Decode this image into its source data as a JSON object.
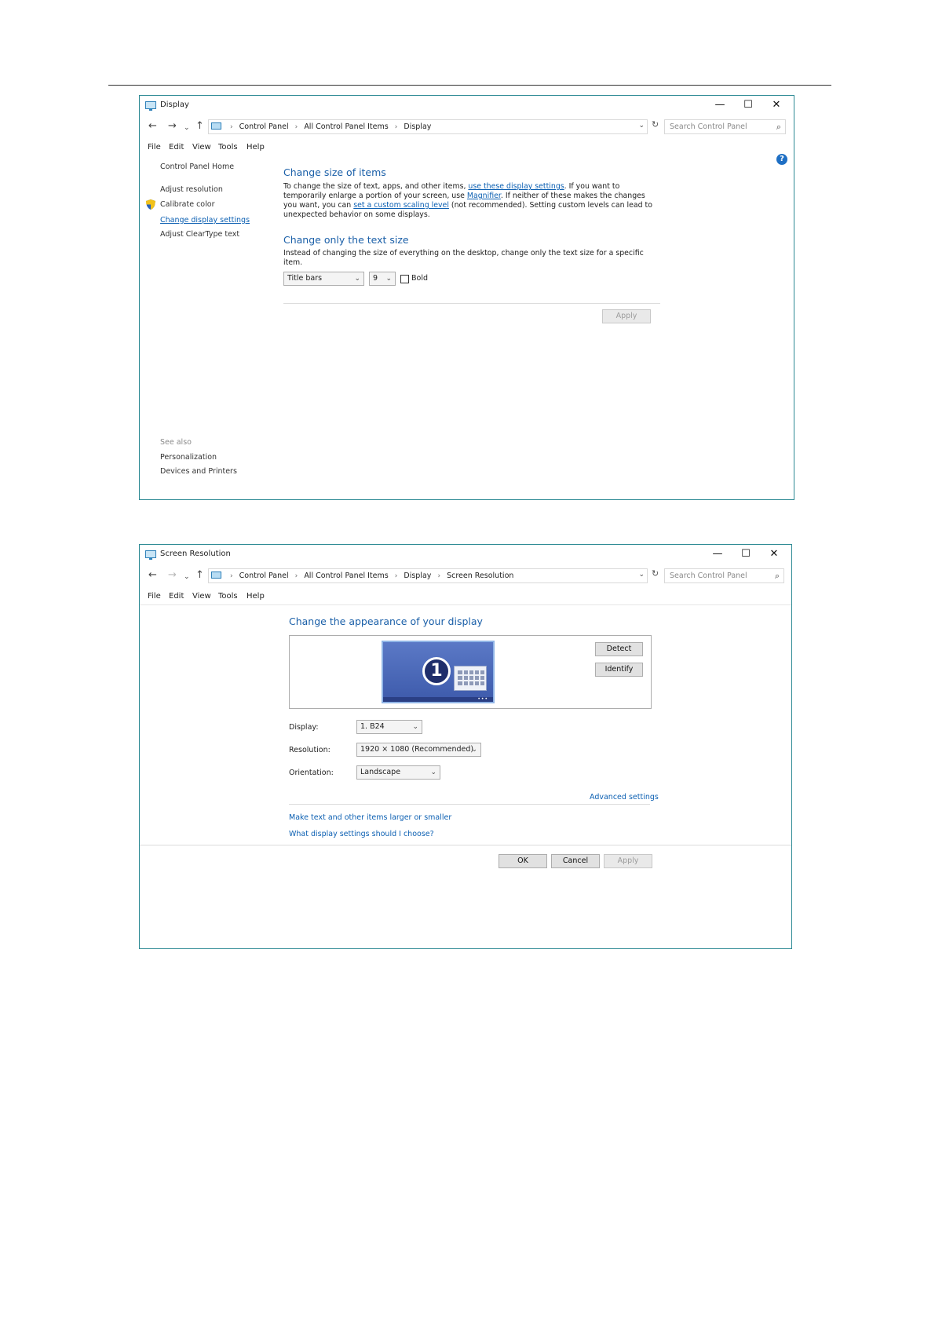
{
  "win1": {
    "title": "Display",
    "controls": {
      "minimize": "—",
      "maximize": "☐",
      "close": "✕"
    },
    "nav": {
      "back": "←",
      "forward": "→",
      "recent": "⌄",
      "up": "↑"
    },
    "breadcrumb": [
      "Control Panel",
      "All Control Panel Items",
      "Display"
    ],
    "search_placeholder": "Search Control Panel",
    "menu": [
      "File",
      "Edit",
      "View",
      "Tools",
      "Help"
    ],
    "help": "?",
    "sidebar": {
      "home": "Control Panel Home",
      "items": [
        "Adjust resolution",
        "Calibrate color",
        "Change display settings",
        "Adjust ClearType text"
      ],
      "see_also": "See also",
      "see_also_items": [
        "Personalization",
        "Devices and Printers"
      ]
    },
    "section1": {
      "heading": "Change size of items",
      "p1": "To change the size of text, apps, and other items, ",
      "link1": "use these display settings",
      "p2": ". If you want to temporarily enlarge a portion of your screen, use ",
      "link2": "Magnifier",
      "p3": ". If neither of these makes the changes you want, you can ",
      "link3": "set a custom scaling level",
      "p4": " (not recommended).  Setting custom levels can lead to unexpected behavior on some displays."
    },
    "section2": {
      "heading": "Change only the text size",
      "text": "Instead of changing the size of everything on the desktop, change only the text size for a specific item.",
      "item_select": "Title bars",
      "size_select": "9",
      "bold_label": "Bold",
      "bold_checked": false
    },
    "apply": "Apply"
  },
  "win2": {
    "title": "Screen Resolution",
    "controls": {
      "minimize": "—",
      "maximize": "☐",
      "close": "✕"
    },
    "nav": {
      "back": "←",
      "forward": "→",
      "recent": "⌄",
      "up": "↑"
    },
    "breadcrumb": [
      "Control Panel",
      "All Control Panel Items",
      "Display",
      "Screen Resolution"
    ],
    "search_placeholder": "Search Control Panel",
    "menu": [
      "File",
      "Edit",
      "View",
      "Tools",
      "Help"
    ],
    "heading": "Change the appearance of your display",
    "monitor_number": "1",
    "detect": "Detect",
    "identify": "Identify",
    "display_label": "Display:",
    "display_value": "1. B24",
    "resolution_label": "Resolution:",
    "resolution_value": "1920 × 1080 (Recommended)",
    "orientation_label": "Orientation:",
    "orientation_value": "Landscape",
    "advanced": "Advanced settings",
    "link_text_size": "Make text and other items larger or smaller",
    "link_help": "What display settings should I choose?",
    "ok": "OK",
    "cancel": "Cancel",
    "apply": "Apply"
  }
}
